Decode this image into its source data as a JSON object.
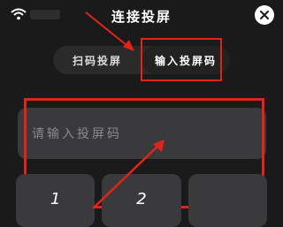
{
  "header": {
    "title": "连接投屏"
  },
  "tabs": [
    {
      "label": "扫码投屏",
      "active": false
    },
    {
      "label": "输入投屏码",
      "active": true
    }
  ],
  "input": {
    "placeholder": "请输入投屏码"
  },
  "keypad": {
    "keys": [
      "1",
      "2",
      ""
    ]
  },
  "colors": {
    "background": "#1a1a1b",
    "panel": "#3a3a3c",
    "annotation": "#e0241a"
  }
}
